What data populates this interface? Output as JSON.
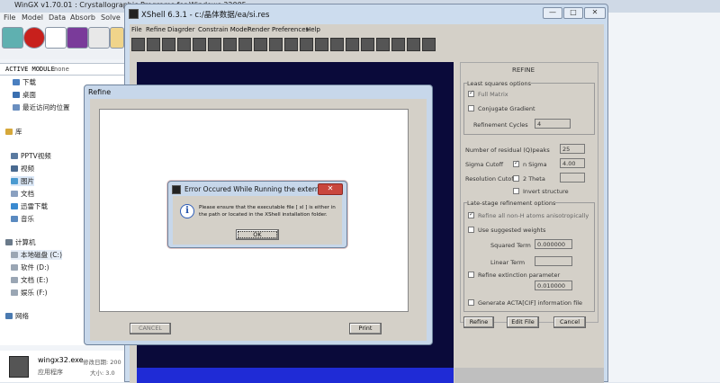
{
  "wingx": {
    "title": "WinGX v1.70.01  :  Crystallographic Programs for Windows 32005",
    "menu": [
      "File",
      "Model",
      "Data",
      "Absorb",
      "Solve"
    ],
    "toolbar_icons": [
      "model-icon",
      "stop-icon",
      "drafting-icon",
      "printer-icon",
      "notes-icon",
      "folder-icon"
    ],
    "active_module_label": "ACTIVE MODULE",
    "active_module_value": "none"
  },
  "explorer": {
    "items": [
      {
        "label": "下载",
        "indent": 2
      },
      {
        "label": "桌面",
        "indent": 2
      },
      {
        "label": "最近访问的位置",
        "indent": 2
      },
      {
        "label": "库",
        "indent": 1
      },
      {
        "label": "PPTV视频",
        "indent": 2
      },
      {
        "label": "视频",
        "indent": 2
      },
      {
        "label": "图片",
        "indent": 2
      },
      {
        "label": "文档",
        "indent": 2
      },
      {
        "label": "迅雷下载",
        "indent": 2
      },
      {
        "label": "音乐",
        "indent": 2
      },
      {
        "label": "计算机",
        "indent": 1
      },
      {
        "label": "本地磁盘 (C:)",
        "indent": 2
      },
      {
        "label": "软件 (D:)",
        "indent": 2
      },
      {
        "label": "文档 (E:)",
        "indent": 2
      },
      {
        "label": "娱乐 (F:)",
        "indent": 2
      },
      {
        "label": "网络",
        "indent": 1
      }
    ],
    "details": {
      "filename": "wingx32.exe",
      "modified_label": "修改日期: 200",
      "type": "应用程序",
      "size_label": "大小: 3.0"
    }
  },
  "xshell": {
    "title": "XShell 6.3.1 - c:/晶体数据/ea/si.res",
    "window_buttons": [
      "—",
      "□",
      "✕"
    ],
    "menu": [
      "File",
      "Refine",
      "Diagrder",
      "Constrain Model",
      "Render",
      "Preferences",
      "Help"
    ],
    "panel": {
      "header": "REFINE",
      "ls_group": "Least squares options",
      "full_matrix": "Full Matrix",
      "full_matrix_checked": true,
      "conjugate_gradient": "Conjugate Gradient",
      "conjugate_gradient_checked": false,
      "refinement_cycles_label": "Refinement Cycles",
      "refinement_cycles": "4",
      "q_peaks_label": "Number of residual (Q)peaks",
      "q_peaks": "25",
      "sigma_cutoff_label": "Sigma Cutoff",
      "n_sigma_label": "n Sigma",
      "n_sigma_checked": true,
      "n_sigma_value": "4.00",
      "resolution_cutoff_label": "Resolution Cutoff",
      "two_theta_label": "2 Theta",
      "two_theta_checked": false,
      "two_theta_value": "",
      "invert_structure_label": "Invert structure",
      "invert_checked": false,
      "late_group": "Late-stage refinement options",
      "aniso_label": "Refine all non-H atoms anisotropically",
      "aniso_checked": true,
      "weights_label": "Use suggested weights",
      "weights_checked": false,
      "squared_term_label": "Squared Term",
      "squared_term": "0.000000",
      "linear_term_label": "Linear Term",
      "linear_term": "",
      "extinction_label": "Refine extinction parameter",
      "extinction_checked": false,
      "extinction_value": "0.010000",
      "acta_label": "Generate ACTA[CIF] information file",
      "acta_checked": false,
      "refine_button": "Refine",
      "edit_file_button": "Edit File",
      "cancel_button": "Cancel"
    }
  },
  "refine_dialog": {
    "title": "Refine",
    "cancel_button": "CANCEL",
    "print_button": "Print"
  },
  "error_dialog": {
    "title": "Error Occured While Running the external...",
    "close": "✕",
    "message": "Please ensure that the executable file [ xl ] is either in the path or located in the XShell installation folder.",
    "ok_button": "OK"
  }
}
